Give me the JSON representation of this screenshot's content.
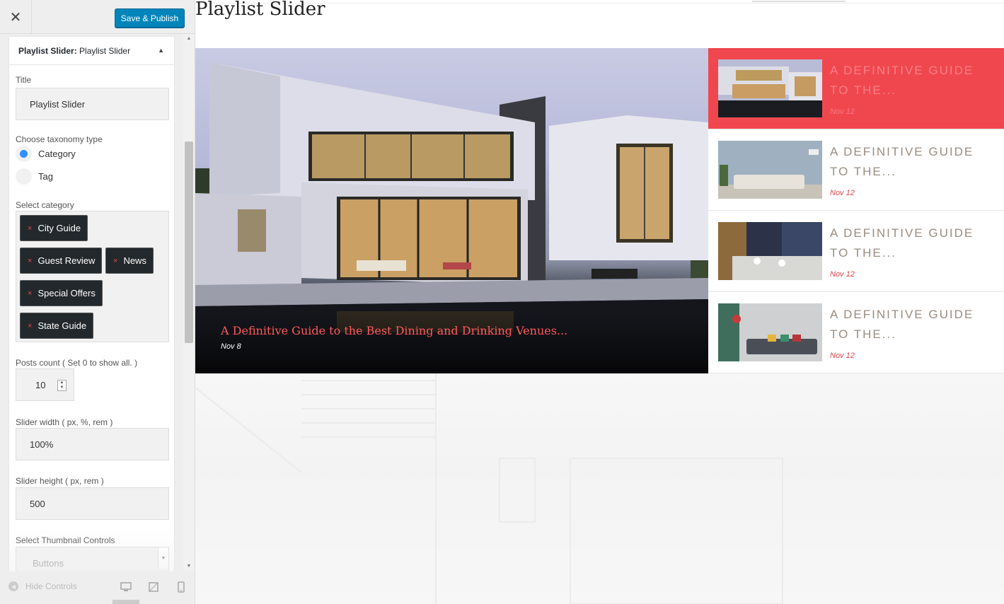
{
  "sidebar": {
    "close_icon": "close-icon",
    "save_label": "Save & Publish",
    "widget": {
      "type_label": "Playlist Slider:",
      "name": "Playlist Slider",
      "title_label": "Title",
      "title_value": "Playlist Slider",
      "taxonomy_label": "Choose taxonomy type",
      "taxonomy_options": [
        {
          "label": "Category",
          "checked": true
        },
        {
          "label": "Tag",
          "checked": false
        }
      ],
      "category_label": "Select category",
      "categories": [
        "City Guide",
        "Guest Review",
        "News",
        "Special Offers",
        "State Guide"
      ],
      "chip_remove": "×",
      "posts_count_label": "Posts count ( Set 0 to show all. )",
      "posts_count_value": "10",
      "slider_width_label": "Slider width ( px, %, rem )",
      "slider_width_value": "100%",
      "slider_height_label": "Slider height ( px, rem )",
      "slider_height_value": "500",
      "thumb_controls_label": "Select Thumbnail Controls",
      "thumb_controls_value": "Buttons"
    },
    "footer": {
      "hide_controls_label": "Hide Controls",
      "devices": [
        "desktop-icon",
        "tablet-icon",
        "mobile-icon"
      ]
    }
  },
  "preview": {
    "title": "Playlist Slider",
    "main_slide": {
      "caption": "A Definitive Guide to the Best Dining and Drinking Venues...",
      "date": "Nov 8"
    },
    "playlist": [
      {
        "title": "A DEFINITIVE GUIDE TO THE...",
        "date": "Nov 12",
        "active": true,
        "thumb": "modern-house-thumbnail"
      },
      {
        "title": "A DEFINITIVE GUIDE TO THE...",
        "date": "Nov 12",
        "active": false,
        "thumb": "living-room-thumbnail"
      },
      {
        "title": "A DEFINITIVE GUIDE TO THE...",
        "date": "Nov 12",
        "active": false,
        "thumb": "dining-table-thumbnail"
      },
      {
        "title": "A DEFINITIVE GUIDE TO THE...",
        "date": "Nov 12",
        "active": false,
        "thumb": "sofa-lamp-thumbnail"
      }
    ]
  },
  "colors": {
    "accent": "#0085ba",
    "active_item": "#f0474f",
    "date_red": "#e0454c",
    "caption_red": "#ff5a5a"
  }
}
